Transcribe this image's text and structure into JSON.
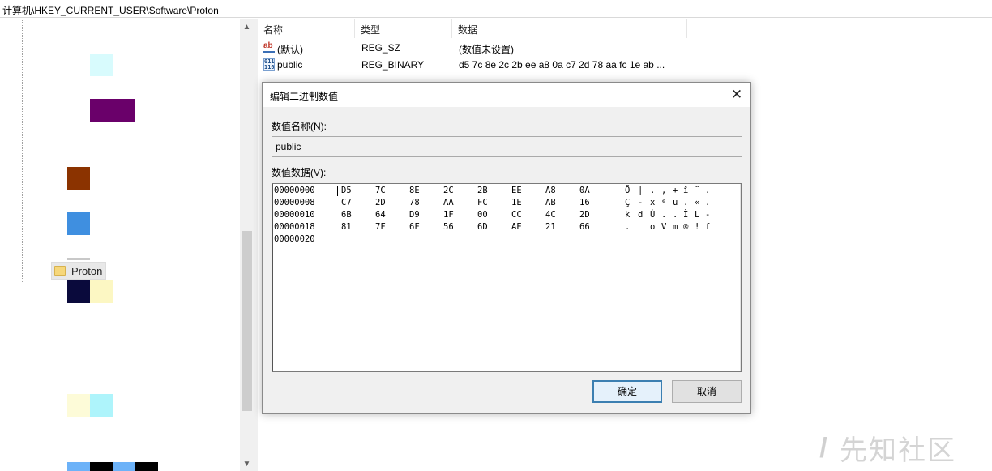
{
  "address_bar": {
    "path": "计算机\\HKEY_CURRENT_USER\\Software\\Proton"
  },
  "tree": {
    "selected_key": "Proton",
    "redaction_colors": [
      "#d8fbfd",
      "#6a006a",
      "#8b3300",
      "#3f8fe0",
      "#0a0a3c",
      "#fcf7c3",
      "#fdfbd8",
      "#aef4fb",
      "#6cb2f8",
      "#000000"
    ]
  },
  "list": {
    "columns": {
      "name": "名称",
      "type": "类型",
      "data": "数据"
    },
    "rows": [
      {
        "icon": "string-value-icon",
        "name": "(默认)",
        "type": "REG_SZ",
        "data": "(数值未设置)"
      },
      {
        "icon": "binary-value-icon",
        "name": "public",
        "type": "REG_BINARY",
        "data": "d5 7c 8e 2c 2b ee a8 0a c7 2d 78 aa fc 1e ab ..."
      }
    ]
  },
  "dialog": {
    "title": "编辑二进制数值",
    "close_glyph": "✕",
    "name_label": "数值名称(N):",
    "name_value": "public",
    "data_label": "数值数据(V):",
    "hex_rows": [
      {
        "addr": "00000000",
        "bytes": [
          "D5",
          "7C",
          "8E",
          "2C",
          "2B",
          "EE",
          "A8",
          "0A"
        ],
        "ascii": [
          "Õ",
          "|",
          ".",
          ",",
          "+",
          "î",
          "¨",
          "."
        ]
      },
      {
        "addr": "00000008",
        "bytes": [
          "C7",
          "2D",
          "78",
          "AA",
          "FC",
          "1E",
          "AB",
          "16"
        ],
        "ascii": [
          "Ç",
          "-",
          "x",
          "ª",
          "ü",
          ".",
          "«",
          "."
        ]
      },
      {
        "addr": "00000010",
        "bytes": [
          "6B",
          "64",
          "D9",
          "1F",
          "00",
          "CC",
          "4C",
          "2D"
        ],
        "ascii": [
          "k",
          "d",
          "Ù",
          ".",
          ".",
          "Ì",
          "L",
          "-"
        ]
      },
      {
        "addr": "00000018",
        "bytes": [
          "81",
          "7F",
          "6F",
          "56",
          "6D",
          "AE",
          "21",
          "66"
        ],
        "ascii": [
          ".",
          "",
          "o",
          "V",
          "m",
          "®",
          "!",
          "f"
        ]
      },
      {
        "addr": "00000020",
        "bytes": [],
        "ascii": []
      }
    ],
    "ok_label": "确定",
    "cancel_label": "取消"
  },
  "watermark": {
    "text": "先知社区"
  },
  "colors": {
    "accent": "#3c7fb1",
    "dialog_bg": "#f0f0f0",
    "tree_selection": "#e8e8e8"
  }
}
